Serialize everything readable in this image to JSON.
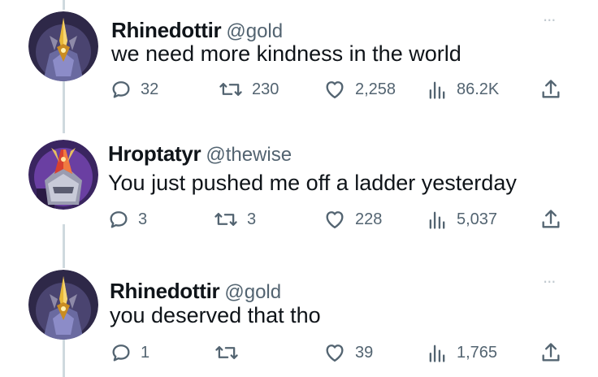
{
  "tweets": [
    {
      "name": "Rhinedottir",
      "handle": "@gold",
      "text": "we need more kindness in the world",
      "avatar": "golden-crowned-knight",
      "replies": "32",
      "retweets": "230",
      "likes": "2,258",
      "views": "86.2K"
    },
    {
      "name": "Hroptatyr",
      "handle": "@thewise",
      "text": "You just pushed me off a ladder yesterday",
      "avatar": "crimson-helmet-knight",
      "replies": "3",
      "retweets": "3",
      "likes": "228",
      "views": "5,037"
    },
    {
      "name": "Rhinedottir",
      "handle": "@gold",
      "text": "you deserved that tho",
      "avatar": "golden-crowned-knight",
      "replies": "1",
      "retweets": "",
      "likes": "39",
      "views": "1,765"
    }
  ],
  "more_label": "...",
  "colors": {
    "muted": "#536471",
    "line": "#cfd9de",
    "more": "#c3cbd1"
  }
}
